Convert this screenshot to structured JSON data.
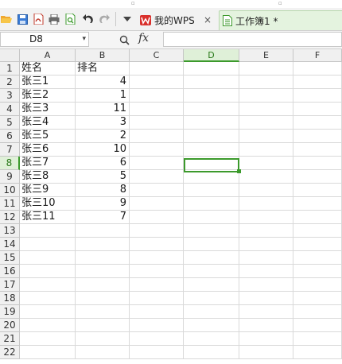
{
  "toolbar": {
    "icons": [
      "open-folder-icon",
      "save-icon",
      "export-pdf-icon",
      "print-icon",
      "print-preview-icon",
      "undo-icon",
      "redo-icon",
      "dropdown-icon"
    ]
  },
  "tabs": [
    {
      "label": "我的WPS",
      "icon": "wps-logo-icon",
      "close": "×"
    },
    {
      "label": "工作簿1 *",
      "icon": "spreadsheet-icon"
    }
  ],
  "formula_bar": {
    "name_box": "D8",
    "fx_label": "fx",
    "formula": ""
  },
  "columns": [
    "A",
    "B",
    "C",
    "D",
    "E",
    "F"
  ],
  "active_cell": {
    "column": "D",
    "row": 8
  },
  "rows": [
    "1",
    "2",
    "3",
    "4",
    "5",
    "6",
    "7",
    "8",
    "9",
    "10",
    "11",
    "12",
    "13",
    "14",
    "15",
    "16",
    "17",
    "18",
    "19",
    "20",
    "21",
    "22"
  ],
  "cells": {
    "A": [
      "姓名",
      "张三1",
      "张三2",
      "张三3",
      "张三4",
      "张三5",
      "张三6",
      "张三7",
      "张三8",
      "张三9",
      "张三10",
      "张三11"
    ],
    "B": [
      "排名",
      "4",
      "1",
      "11",
      "3",
      "2",
      "10",
      "6",
      "5",
      "8",
      "9",
      "7"
    ]
  },
  "colors": {
    "accent": "#3c9a2c",
    "active_header": "#dff0d8"
  }
}
